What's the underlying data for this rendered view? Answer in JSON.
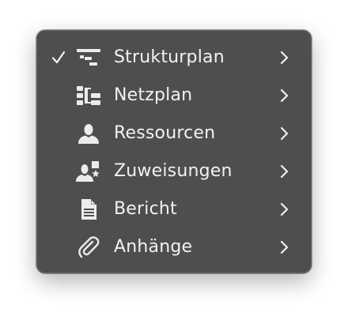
{
  "menu": {
    "items": [
      {
        "label": "Strukturplan",
        "checked": true,
        "icon": "wbs-structure-icon"
      },
      {
        "label": "Netzplan",
        "checked": false,
        "icon": "network-plan-icon"
      },
      {
        "label": "Ressourcen",
        "checked": false,
        "icon": "person-icon"
      },
      {
        "label": "Zuweisungen",
        "checked": false,
        "icon": "person-star-icon"
      },
      {
        "label": "Bericht",
        "checked": false,
        "icon": "document-icon"
      },
      {
        "label": "Anhänge",
        "checked": false,
        "icon": "paperclip-icon"
      }
    ],
    "check_glyph": "✓"
  },
  "colors": {
    "menu_background": "#4e4e50",
    "menu_border": "#6a6a6c",
    "text": "#f2f2f2",
    "page_background": "#ffffff"
  }
}
